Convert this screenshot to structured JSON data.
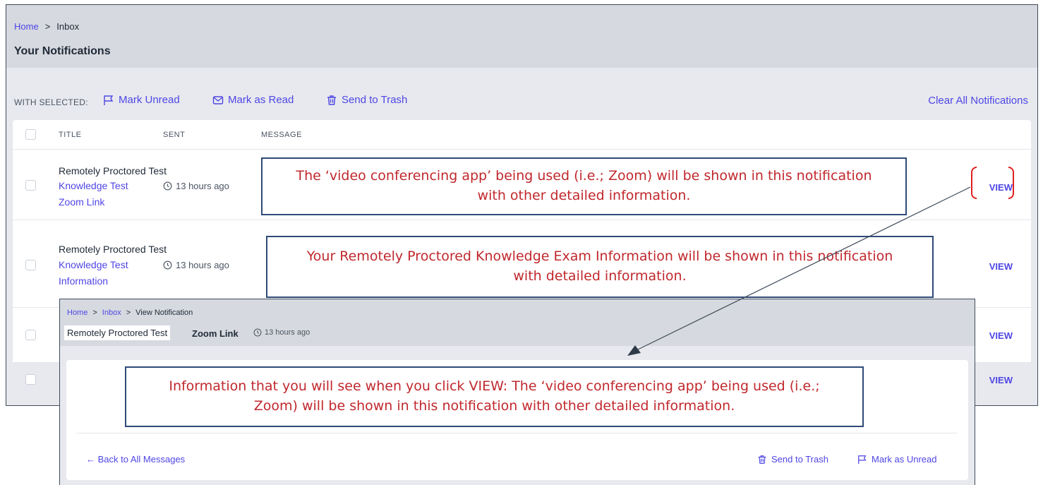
{
  "main": {
    "breadcrumb": {
      "home": "Home",
      "sep": ">",
      "current": "Inbox"
    },
    "page_title": "Your Notifications",
    "toolbar": {
      "with_selected": "WITH SELECTED:",
      "mark_unread": "Mark Unread",
      "mark_as_read": "Mark as Read",
      "send_to_trash": "Send to Trash",
      "clear_all": "Clear All Notifications"
    },
    "table": {
      "headers": {
        "title": "TITLE",
        "sent": "SENT",
        "message": "MESSAGE"
      },
      "rows": [
        {
          "title_main": "Remotely Proctored Test",
          "title_link_1": "Knowledge Test",
          "title_link_2": "Zoom Link",
          "sent": "13 hours ago",
          "view": "VIEW"
        },
        {
          "title_main": "Remotely Proctored Test",
          "title_link_1": "Knowledge Test",
          "title_link_2": "Information",
          "sent": "13 hours ago",
          "view": "VIEW"
        },
        {
          "view": "VIEW"
        },
        {
          "view": "VIEW"
        }
      ]
    }
  },
  "notes": {
    "note1": "The ‘video conferencing app’ being used (i.e.; Zoom) will be shown in this notification with other detailed information.",
    "note2": "Your Remotely Proctored Knowledge Exam Information will be shown in this notification with detailed information.",
    "note3": "Information that you will see when you click VIEW:  The ‘video conferencing app’ being used (i.e.; Zoom) will be shown in this notification with other detailed information."
  },
  "overlay": {
    "breadcrumb": {
      "home": "Home",
      "sep": ">",
      "inbox": "Inbox",
      "current": "View Notification"
    },
    "title_highlight": "Remotely Proctored Test",
    "title_rest": "Zoom Link",
    "sent": "13 hours ago",
    "back": "← Back to All Messages",
    "send_to_trash": "Send to Trash",
    "mark_as_unread": "Mark as Unread"
  },
  "colors": {
    "accent": "#4f46e5",
    "annotation_text": "#c0282d",
    "annotation_border": "#2f4a78",
    "bracket": "#e02020"
  }
}
